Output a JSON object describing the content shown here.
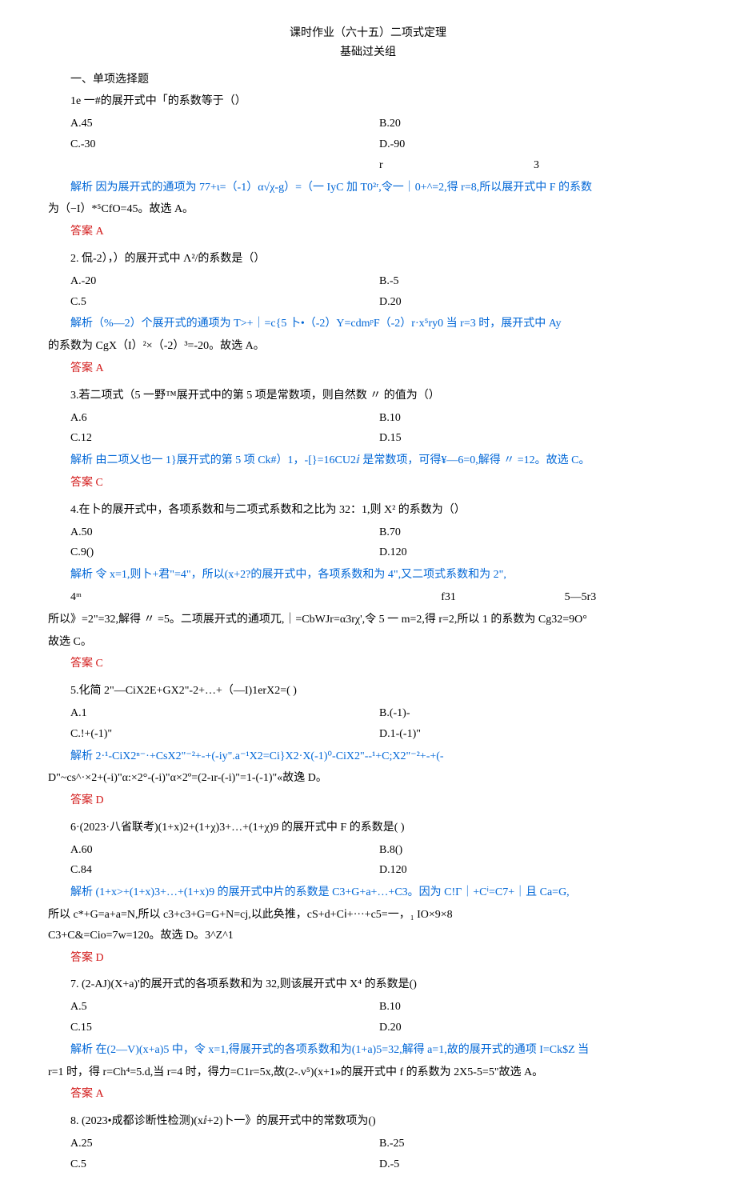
{
  "header": {
    "title": "课时作业（六十五）二项式定理",
    "subtitle": "基础过关组"
  },
  "section1_title": "一、单项选择题",
  "q1": {
    "stem": "1e 一#的展开式中「的系数等于（）",
    "A": "A.45",
    "B": "B.20",
    "C": "C.-30",
    "D": "D.-90",
    "inter_r": "r",
    "inter_3": "3",
    "analysis": "解析 因为展开式的通项为 77+ι=（-1）α√χ-g）=（一 IyC 加 T0²ʳ,令一｜0+^=2,得 r=8,所以展开式中 F 的系数",
    "analysis2": "为（−I）*⁵CfO=45。故选 A。",
    "answer": "答案 A"
  },
  "q2": {
    "stem": "2. 侃-2），）的展开式中 Λ²/的系数是（）",
    "A": "A.-20",
    "B": "B.-5",
    "C": "C.5",
    "D": "D.20",
    "analysis": "解析（%—2）个展开式的通项为 T>+｜=c{5 卜•（-2）Y=cdmᵖF（-2）r·x⁵ry0 当 r=3 时，展开式中 Ay",
    "analysis2": "的系数为 CgX（I）²×（-2）³=-20。故选 A。",
    "answer": "答案 A"
  },
  "q3": {
    "stem": "3.若二项式（5 一野™展开式中的第 5 项是常数项，则自然数 〃 的值为（）",
    "A": "A.6",
    "B": "B.10",
    "C": "C.12",
    "D": "D.15",
    "analysis": "解析 由二项乂也一 1}展开式的第 5 项 Ck#）1，-[}=16CU2ⅈ 是常数项，可得¥—6=0,解得 〃 =12。故选 C。",
    "answer": "答案 C"
  },
  "q4": {
    "stem": "4.在卜的展开式中，各项系数和与二项式系数和之比为 32：1,则 X² 的系数为（）",
    "A": "A.50",
    "B": "B.70",
    "C": "C.9()",
    "D": "D.120",
    "analysis": "解析 令 x=1,则卜+君\"=4\"，所以(x+2?的展开式中，各项系数和为 4\",又二项式系数和为 2\",",
    "inline_a": "4ᵐ",
    "inline_b": "f31",
    "inline_c": "5—5r3",
    "analysis2": "所以》=2\"=32,解得 〃 =5。二项展开式的通项兀,｜=CbWJr=α3rχ',令 5 一 m=2,得 r=2,所以 1 的系数为 Cg32=9O°",
    "analysis3": "故选 C。",
    "answer": "答案 C"
  },
  "q5": {
    "stem": "5.化简 2\"—CiX2E+GX2\"-2+…+（—I)1erX2=(                )",
    "A": "A.1",
    "B": "B.(-1)-",
    "C": "C.!+(-1)\"",
    "D": "D.1-(-1)\"",
    "analysis": "解析 2·¹-CiX2ⁿ⁻·+CsX2\"⁻²+-+(-iy\".a⁻¹X2=Ci}X2·X(-1)⁰-CiX2\"--¹+C;X2\"⁻²+-+(-",
    "analysis2": "D\"~cs^·×2+(-i)\"α:×2°-(-i)\"α×2º=(2-ır-(-i)\"=1-(-1)\"«故逸 D。",
    "answer": "答案 D"
  },
  "q6": {
    "stem": "6·(2023·八省联考)(1+x)2+(1+χ)3+…+(1+χ)9 的展开式中 F 的系数是(          )",
    "A": "A.60",
    "B": "B.8()",
    "C": "C.84",
    "D": "D.120",
    "analysis": "解析 (1+x>+(1+x)3+…+(1+x)9 的展开式中片的系数是 C3+G+a+…+C3。因为 C!Γ｜+Cⁱ=C7+｜且 Ca=G,",
    "analysis2a": "所以 c*+G=a+a=N,所以 c3+c3+G=G+N=cj,以此奂推，cS+d+Cⅰ+···+c5=一，₁       IO×9×8",
    "analysis2b": "C3+C&=Cio=7w=120。故选 D。3^Z^1",
    "answer": "答案 D"
  },
  "q7": {
    "stem": "7.    (2-AJ)(X+a)'的展开式的各项系数和为 32,则该展开式中 X⁴ 的系数是()",
    "A": "A.5",
    "B": "B.10",
    "C": "C.15",
    "D": "D.20",
    "analysis": "解析 在(2—V)(x+a)5 中，令 x=1,得展开式的各项系数和为(1+a)5=32,解得 a=1,故的展开式的通项 I=Ck$Z 当",
    "analysis2": "r=1 时，得 r=Ch⁴=5.d,当 r=4 时，得力=C1r=5x,故(2-.v⁵)(x+1»的展开式中 f 的系数为 2X5-5=5\"故选 A。",
    "answer": "答案 A"
  },
  "q8": {
    "stem": "8.    (2023•成都诊断性检测)(xⅈ+2)卜一》的展开式中的常数项为()",
    "A": "A.25",
    "B": "B.-25",
    "C": "C.5",
    "D": "D.-5"
  }
}
